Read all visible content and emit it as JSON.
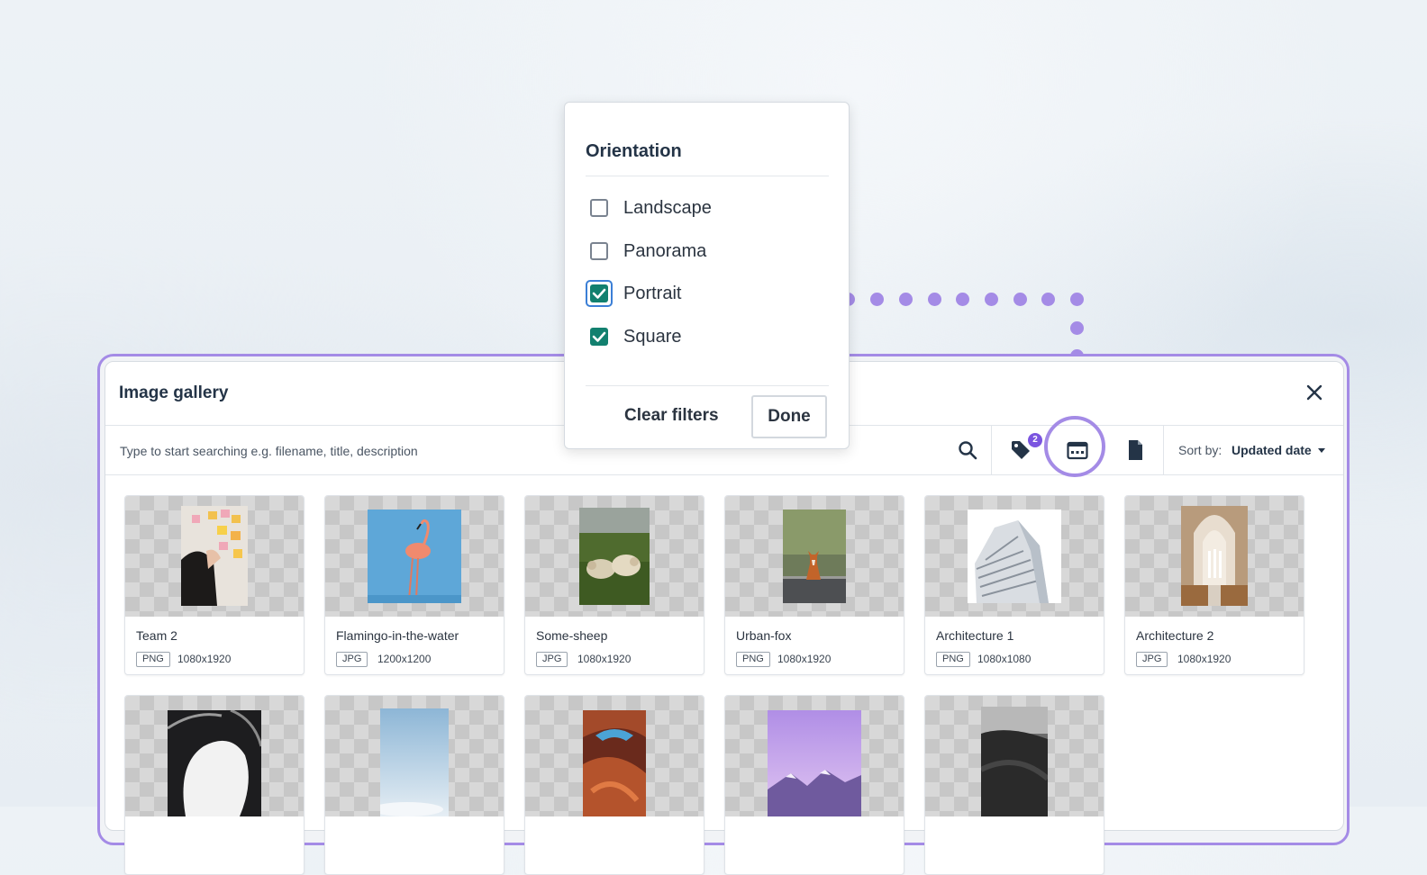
{
  "gallery": {
    "title": "Image gallery",
    "search_placeholder": "Type to start searching e.g. filename, title, description",
    "tag_badge_count": "2",
    "sort_label": "Sort by:",
    "sort_value": "Updated date",
    "icons": [
      "search-icon",
      "tag-icon",
      "orientation-filter-icon",
      "file-type-icon",
      "close-icon",
      "caret-down-icon"
    ],
    "accent_color": "#a48be6",
    "badge_color": "#7b55e0"
  },
  "filter": {
    "title": "Orientation",
    "options": [
      {
        "label": "Landscape",
        "checked": false
      },
      {
        "label": "Panorama",
        "checked": false
      },
      {
        "label": "Portrait",
        "checked": true
      },
      {
        "label": "Square",
        "checked": true
      }
    ],
    "clear_label": "Clear filters",
    "done_label": "Done",
    "checked_color": "#12806f"
  },
  "images": [
    {
      "name": "Team 2",
      "format": "PNG",
      "size": "1080x1920"
    },
    {
      "name": "Flamingo-in-the-water",
      "format": "JPG",
      "size": "1200x1200"
    },
    {
      "name": "Some-sheep",
      "format": "JPG",
      "size": "1080x1920"
    },
    {
      "name": "Urban-fox",
      "format": "PNG",
      "size": "1080x1920"
    },
    {
      "name": "Architecture 1",
      "format": "PNG",
      "size": "1080x1080"
    },
    {
      "name": "Architecture 2",
      "format": "JPG",
      "size": "1080x1920"
    },
    {
      "name": "",
      "format": "",
      "size": ""
    },
    {
      "name": "",
      "format": "",
      "size": ""
    },
    {
      "name": "",
      "format": "",
      "size": ""
    },
    {
      "name": "",
      "format": "",
      "size": ""
    },
    {
      "name": "",
      "format": "",
      "size": ""
    }
  ]
}
